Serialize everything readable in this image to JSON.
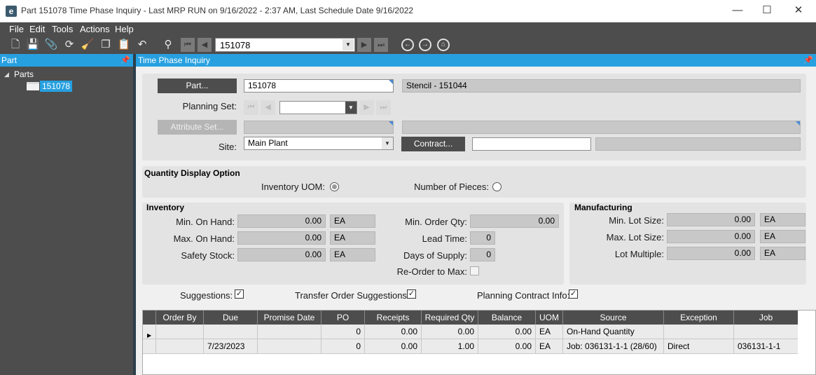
{
  "window": {
    "title": "Part 151078 Time Phase Inquiry  - Last MRP RUN on 9/16/2022 - 2:37 AM, Last Schedule Date  9/16/2022",
    "icon_letter": "e",
    "controls": {
      "minimize": "—",
      "maximize": "☐",
      "close": "✕"
    }
  },
  "menu": {
    "items": [
      "File",
      "Edit",
      "Tools",
      "Actions",
      "Help"
    ]
  },
  "toolbar": {
    "part_value": "151078",
    "icons": [
      "new-icon",
      "save-icon",
      "attach-icon",
      "refresh-icon",
      "clear-icon",
      "copy-icon",
      "paste-icon",
      "undo-icon",
      "search-binoculars-icon",
      "first-icon",
      "prev-icon",
      "next-icon",
      "last-icon",
      "back-icon",
      "forward-icon",
      "home-icon"
    ]
  },
  "left_panel": {
    "title": "Part",
    "tree_root": "Parts",
    "selected_item": "151078"
  },
  "main": {
    "title": "Time Phase Inquiry",
    "part_button": "Part...",
    "part_value": "151078",
    "part_description": "Stencil - 151044",
    "planning_set_label": "Planning Set:",
    "planning_set_value": "",
    "attribute_set_button": "Attribute Set...",
    "site_label": "Site:",
    "site_value": "Main Plant",
    "contract_button": "Contract...",
    "contract_value": ""
  },
  "quantity_display": {
    "title": "Quantity Display Option",
    "inventory_uom_label": "Inventory UOM:",
    "inventory_uom_selected": true,
    "pieces_label": "Number of Pieces:",
    "pieces_selected": false
  },
  "inventory": {
    "title": "Inventory",
    "min_on_hand_label": "Min. On Hand:",
    "min_on_hand": "0.00",
    "min_on_hand_uom": "EA",
    "max_on_hand_label": "Max. On Hand:",
    "max_on_hand": "0.00",
    "max_on_hand_uom": "EA",
    "safety_stock_label": "Safety Stock:",
    "safety_stock": "0.00",
    "safety_stock_uom": "EA",
    "min_order_qty_label": "Min. Order Qty:",
    "min_order_qty": "0.00",
    "lead_time_label": "Lead Time:",
    "lead_time": "0",
    "days_of_supply_label": "Days of Supply:",
    "days_of_supply": "0",
    "reorder_label": "Re-Order to Max:",
    "reorder_checked": false
  },
  "manufacturing": {
    "title": "Manufacturing",
    "min_lot_label": "Min. Lot Size:",
    "min_lot": "0.00",
    "min_lot_uom": "EA",
    "max_lot_label": "Max. Lot Size:",
    "max_lot": "0.00",
    "max_lot_uom": "EA",
    "lot_multiple_label": "Lot Multiple:",
    "lot_multiple": "0.00",
    "lot_multiple_uom": "EA"
  },
  "options": {
    "suggestions_label": "Suggestions:",
    "transfer_label": "Transfer Order Suggestions:",
    "planning_contract_label": "Planning Contract Info:",
    "check_mark": "✓"
  },
  "grid": {
    "columns": [
      "Order By",
      "Due",
      "Promise Date",
      "PO",
      "Receipts",
      "Required Qty",
      "Balance",
      "UOM",
      "Source",
      "Exception",
      "Job"
    ],
    "rows": [
      [
        "",
        "",
        "",
        "0",
        "0.00",
        "0.00",
        "0.00",
        "EA",
        "On-Hand Quantity",
        "",
        ""
      ],
      [
        "",
        "7/23/2023",
        "",
        "0",
        "0.00",
        "1.00",
        "0.00",
        "EA",
        "Job: 036131-1-1 (28/60)",
        "Direct",
        "036131-1-1"
      ]
    ]
  }
}
